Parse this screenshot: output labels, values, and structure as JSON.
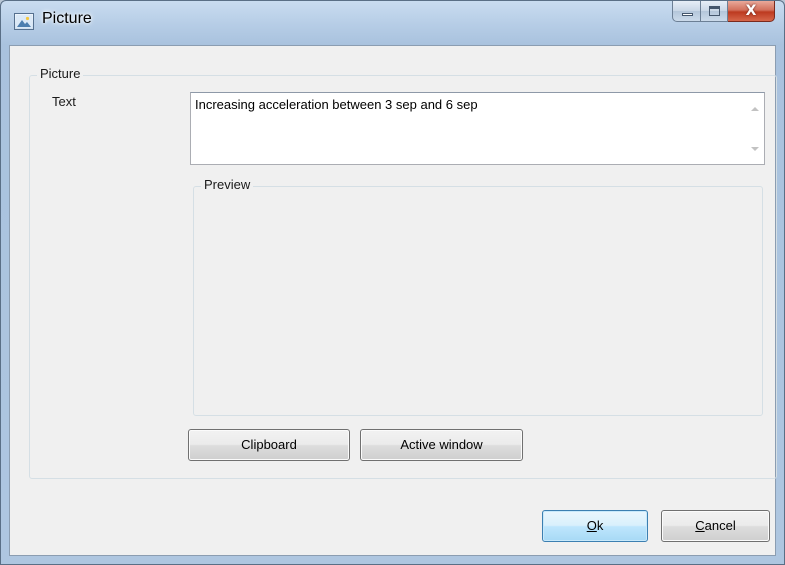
{
  "window": {
    "title": "Picture",
    "icon": "picture-icon",
    "caption_buttons": {
      "minimize": "minimize-icon",
      "maximize": "maximize-icon",
      "close": "close-icon",
      "close_glyph": "X"
    }
  },
  "form": {
    "group_label": "Picture",
    "text_label": "Text",
    "text_value": "Increasing acceleration between 3 sep and 6 sep",
    "preview_label": "Preview"
  },
  "buttons": {
    "clipboard": "Clipboard",
    "active_window": "Active window",
    "ok_mnemonic": "O",
    "ok_rest": "k",
    "cancel_mnemonic": "C",
    "cancel_rest": "ancel"
  },
  "colors": {
    "titlebar": "#b6cde6",
    "client_background": "#f0f0f0",
    "close_button": "#c8452d",
    "default_button_border": "#3c7fb1"
  }
}
